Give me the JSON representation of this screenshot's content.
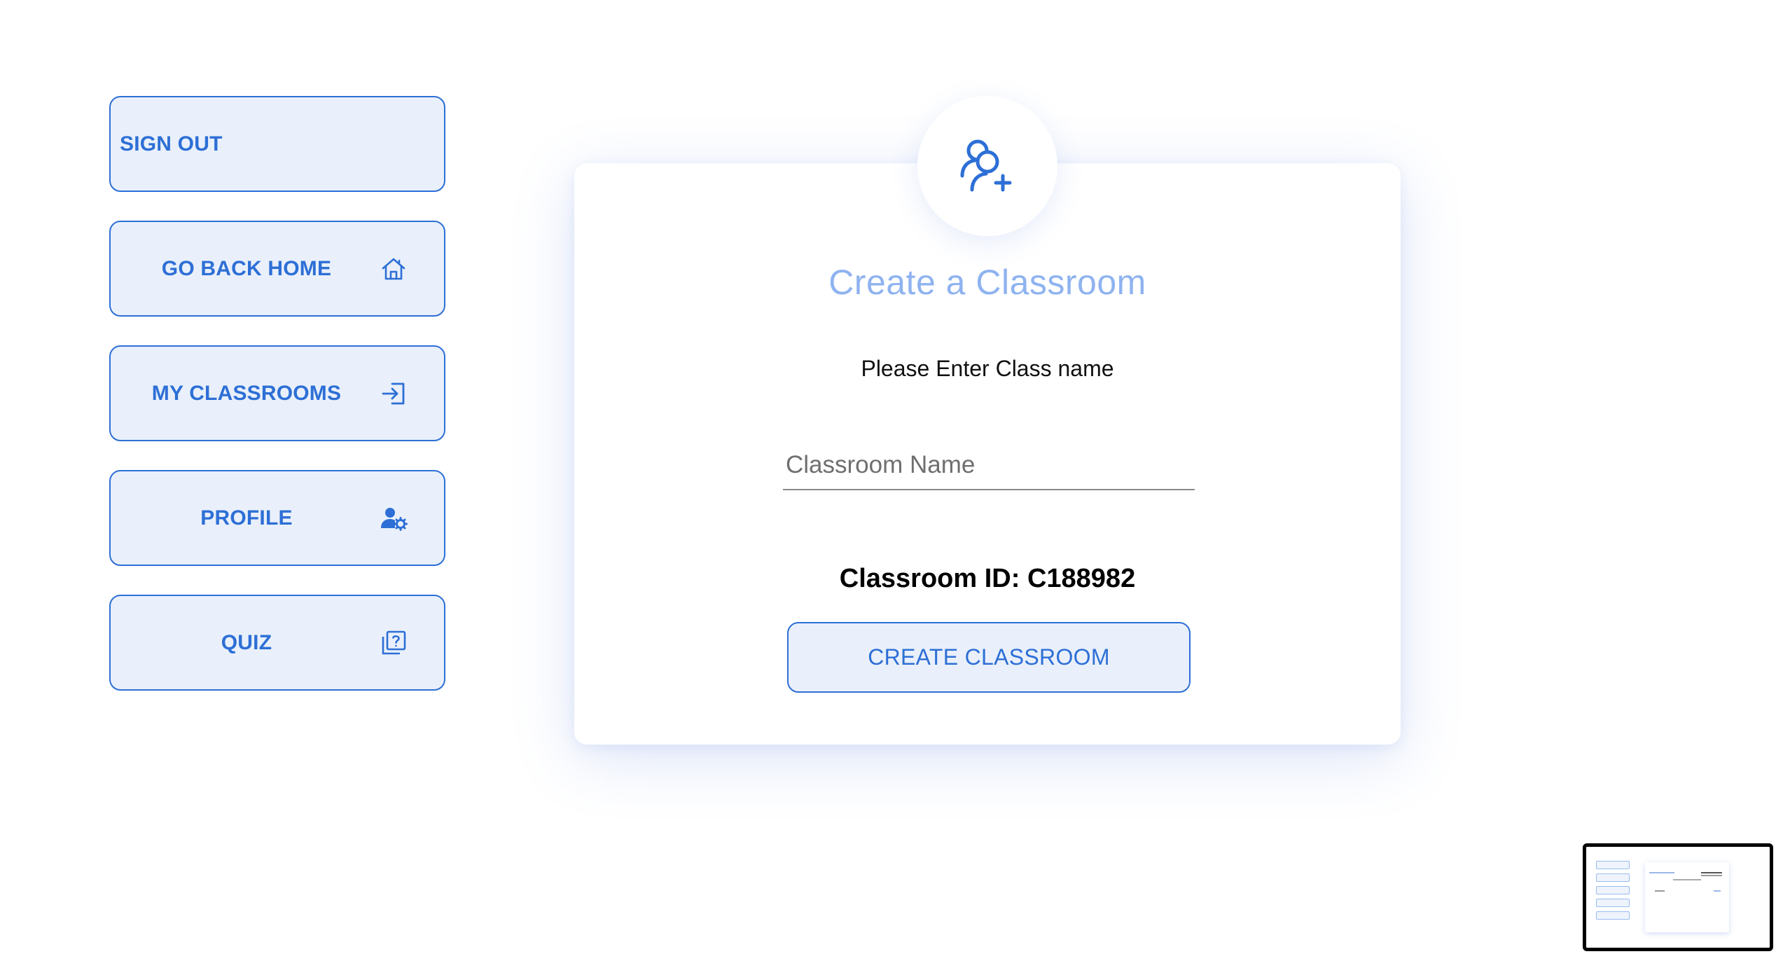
{
  "sidebar": {
    "items": [
      {
        "label": "SIGN OUT",
        "icon": null
      },
      {
        "label": "GO BACK HOME",
        "icon": "home-icon"
      },
      {
        "label": "MY CLASSROOMS",
        "icon": "sign-in-icon"
      },
      {
        "label": "PROFILE",
        "icon": "user-settings-icon"
      },
      {
        "label": "QUIZ",
        "icon": "quiz-icon"
      }
    ]
  },
  "card": {
    "header_icon": "add-user-icon",
    "title": "Create a Classroom",
    "prompt": "Please Enter Class name",
    "input_placeholder": "Classroom Name",
    "input_value": "",
    "classroom_id_text": "Classroom ID: C188982",
    "create_button_label": "CREATE CLASSROOM"
  },
  "preview_thumbnail": {
    "icon": "screen-preview-thumbnail"
  },
  "colors": {
    "accent": "#2d6fd6",
    "button_bg": "#e9f0fb",
    "title": "#8fb3f0"
  }
}
